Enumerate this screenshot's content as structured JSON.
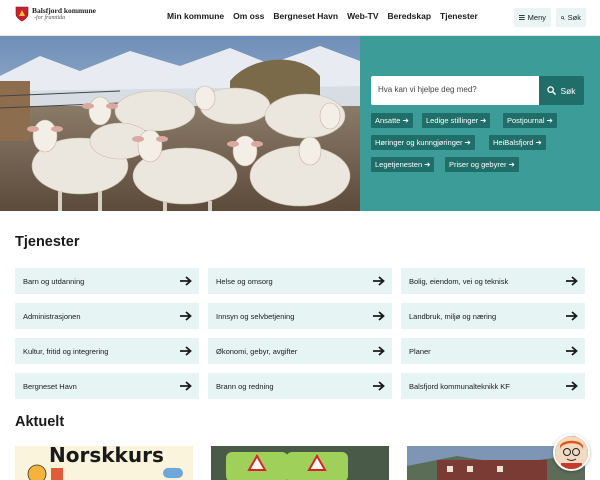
{
  "header": {
    "logo_name": "Balsfjord kommune",
    "logo_tagline": "-for framtida",
    "nav": [
      "Min kommune",
      "Om oss",
      "Bergneset Havn",
      "Web-TV",
      "Beredskap",
      "Tjenester"
    ],
    "menu_label": "Meny",
    "search_label": "Søk"
  },
  "hero": {
    "search_placeholder": "Hva kan vi hjelpe deg med?",
    "search_button": "Søk",
    "quick_links": [
      "Ansatte",
      "Ledige stillinger",
      "Postjournal",
      "Høringer og kunngjøringer",
      "HeiBalsfjord",
      "Legetjenesten",
      "Priser og gebyrer"
    ]
  },
  "services": {
    "title": "Tjenester",
    "items": [
      "Barn og utdanning",
      "Helse og omsorg",
      "Bolig, eiendom, vei og teknisk",
      "Administrasjonen",
      "Innsyn og selvbetjening",
      "Landbruk, miljø og næring",
      "Kultur, fritid og integrering",
      "Økonomi, gebyr, avgifter",
      "Planer",
      "Bergneset Havn",
      "Brann og redning",
      "Balsfjord kommunalteknikk KF"
    ]
  },
  "news": {
    "title": "Aktuelt",
    "card1_heading": "Norskkurs"
  },
  "colors": {
    "teal_panel": "#3b9c98",
    "teal_dark": "#1f6e6a",
    "service_bg": "#e6f4f3"
  },
  "icons": [
    "shield-logo-icon",
    "hamburger-icon",
    "search-icon",
    "arrow-right-icon",
    "chat-avatar-icon"
  ]
}
